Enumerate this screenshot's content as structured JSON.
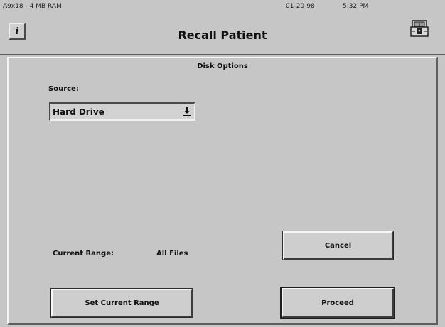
{
  "header": {
    "system_info": "A9x18 - 4 MB RAM",
    "date": "01-20-98",
    "time": "5:32 PM",
    "info_button_label": "i",
    "title": "Recall Patient",
    "lock_icon": "lock-icon"
  },
  "panel": {
    "title": "Disk Options",
    "source_label": "Source:",
    "source_value": "Hard Drive",
    "dropdown_icon": "download-arrow-icon",
    "current_range_label": "Current Range:",
    "current_range_value": "All Files"
  },
  "buttons": {
    "cancel": "Cancel",
    "set_range": "Set Current Range",
    "proceed": "Proceed"
  }
}
